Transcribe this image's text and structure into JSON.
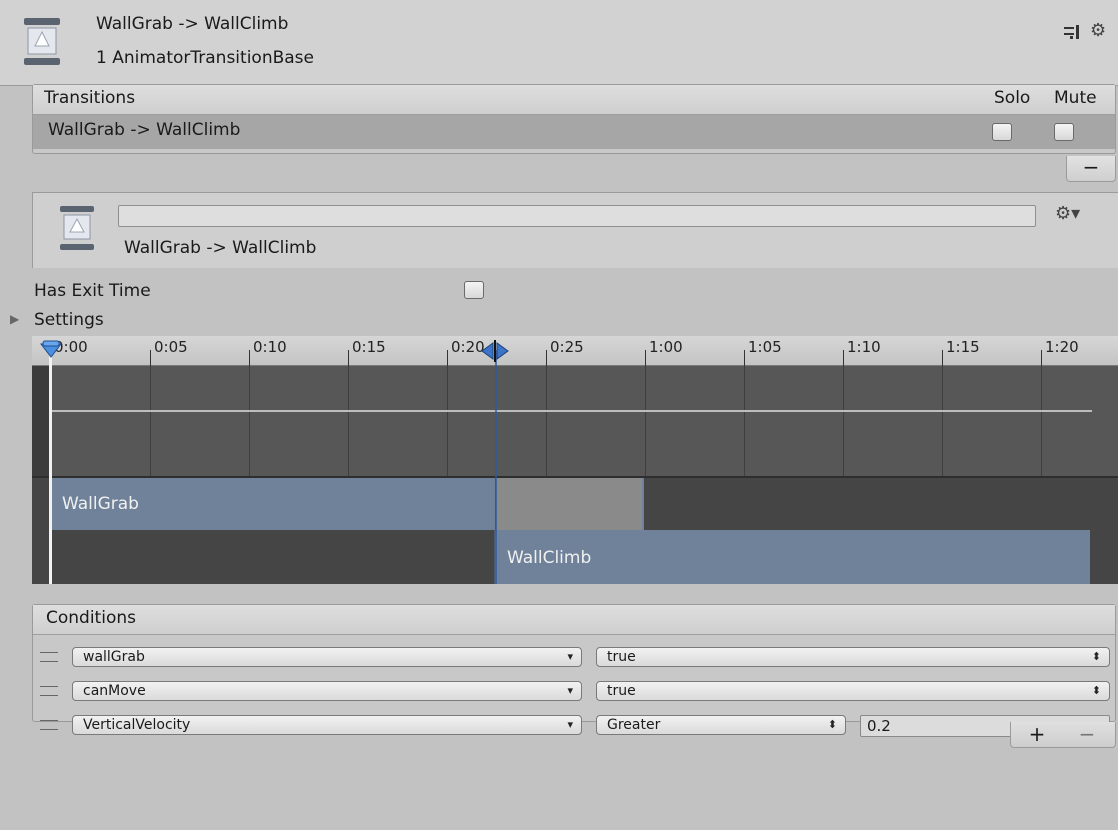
{
  "header": {
    "title": "WallGrab -> WallClimb",
    "subtitle": "1 AnimatorTransitionBase",
    "preset_icon": "preset-icon",
    "gear_icon": "gear-icon"
  },
  "transitions": {
    "heading": "Transitions",
    "solo_label": "Solo",
    "mute_label": "Mute",
    "rows": [
      {
        "label": "WallGrab -> WallClimb",
        "solo": false,
        "mute": false
      }
    ],
    "remove_label": "−"
  },
  "transition_detail": {
    "name_value": "",
    "title": "WallGrab -> WallClimb"
  },
  "has_exit_time": {
    "label": "Has Exit Time",
    "checked": false
  },
  "settings": {
    "label": "Settings",
    "expanded": false
  },
  "timeline": {
    "ticks": [
      "0:00",
      "0:05",
      "0:10",
      "0:15",
      "0:20",
      "0:25",
      "1:00",
      "1:05",
      "1:10",
      "1:15",
      "1:20"
    ],
    "source_clip": "WallGrab",
    "destination_clip": "WallClimb"
  },
  "conditions": {
    "heading": "Conditions",
    "rows": [
      {
        "parameter": "wallGrab",
        "mode": "true",
        "value": ""
      },
      {
        "parameter": "canMove",
        "mode": "true",
        "value": ""
      },
      {
        "parameter": "VerticalVelocity",
        "mode": "Greater",
        "value": "0.2"
      }
    ],
    "add_label": "+",
    "remove_label": "−"
  }
}
